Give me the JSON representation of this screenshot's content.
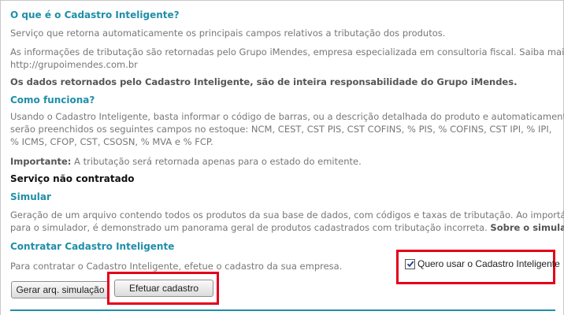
{
  "section1": {
    "heading": "O que é o Cadastro Inteligente?",
    "line1": "Serviço que retorna automaticamente os principais campos relativos a tributação dos produtos.",
    "line2a": "As informações de tributação são retornadas pelo Grupo iMendes, empresa especializada em consultoria fiscal. Saiba mais:",
    "line2b": "http://grupoimendes.com.br",
    "line3": "Os dados retornados pelo Cadastro Inteligente, são de inteira responsabilidade do Grupo iMendes."
  },
  "section2": {
    "heading": "Como funciona?",
    "line1": "Usando o Cadastro Inteligente, basta informar o código de barras, ou a descrição detalhada do produto e automaticamente,",
    "line2": "serão preenchidos os seguintes campos no estoque: NCM, CEST, CST PIS, CST COFINS, % PIS, % COFINS, CST IPI, % IPI,",
    "line3": "% ICMS, CFOP, CST, CSOSN, % MVA e % FCP.",
    "important_label": "Importante:",
    "important_text": " A tributação será retornada apenas para o estado do emitente."
  },
  "status": "Serviço não contratado",
  "section3": {
    "heading": "Simular",
    "line1": "Geração de um arquivo contendo todos os produtos da sua base de dados, com códigos e taxas de tributação. Ao importá-lo",
    "line2": "para o simulador, é demonstrado um panorama geral de produtos cadastrados com tributação incorreta. ",
    "line2_link": "Sobre o simulador."
  },
  "section4": {
    "heading": "Contratar Cadastro Inteligente",
    "line1": "Para contratar o Cadastro Inteligente, efetue o cadastro da sua empresa."
  },
  "checkbox": {
    "label": "Quero usar o Cadastro Inteligente",
    "checked": true
  },
  "buttons": {
    "simulate": "Gerar arq. simulação",
    "register": "Efetuar cadastro"
  },
  "colors": {
    "heading": "#1f8fa8",
    "highlight": "#e3001b"
  }
}
